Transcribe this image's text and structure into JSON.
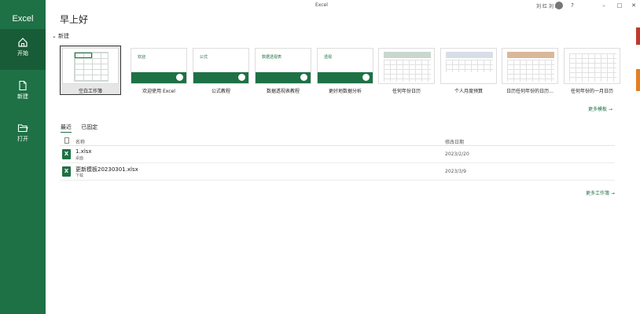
{
  "app": {
    "title": "Excel",
    "window_title": "Excel",
    "user_name": "刘 红 刘 红"
  },
  "sidebar": {
    "items": [
      {
        "label": "开始",
        "icon": "home-icon"
      },
      {
        "label": "新建",
        "icon": "new-file-icon"
      },
      {
        "label": "打开",
        "icon": "folder-open-icon"
      }
    ]
  },
  "greeting": "早上好",
  "new_section": {
    "label": "新建"
  },
  "templates": [
    {
      "name": "空白工作簿"
    },
    {
      "name": "欢迎使用 Excel",
      "thumb_text": "欢迎"
    },
    {
      "name": "公式教程",
      "thumb_text": "公式"
    },
    {
      "name": "数据透视表教程",
      "thumb_text": "数据透视表"
    },
    {
      "name": "更好地数据分析",
      "thumb_text": "透视"
    },
    {
      "name": "任何年份日历"
    },
    {
      "name": "个人月度预算"
    },
    {
      "name": "日历任何年份的日历..."
    },
    {
      "name": "任何年份的一月日历"
    }
  ],
  "more_templates": "更多模板 →",
  "tabs": [
    {
      "label": "最近"
    },
    {
      "label": "已固定"
    }
  ],
  "file_list": {
    "columns": {
      "name": "名称",
      "date": "修改日期"
    },
    "rows": [
      {
        "name": "1.xlsx",
        "location": "桌面",
        "date": "2023/2/20"
      },
      {
        "name": "更新模板20230301.xlsx",
        "location": "下载",
        "date": "2023/3/9"
      }
    ]
  },
  "more_workbooks": "更多工作簿 →",
  "colors": {
    "accent": "#1e7145",
    "sidebar": "#1e7145",
    "sidebar_active": "#185c37"
  }
}
